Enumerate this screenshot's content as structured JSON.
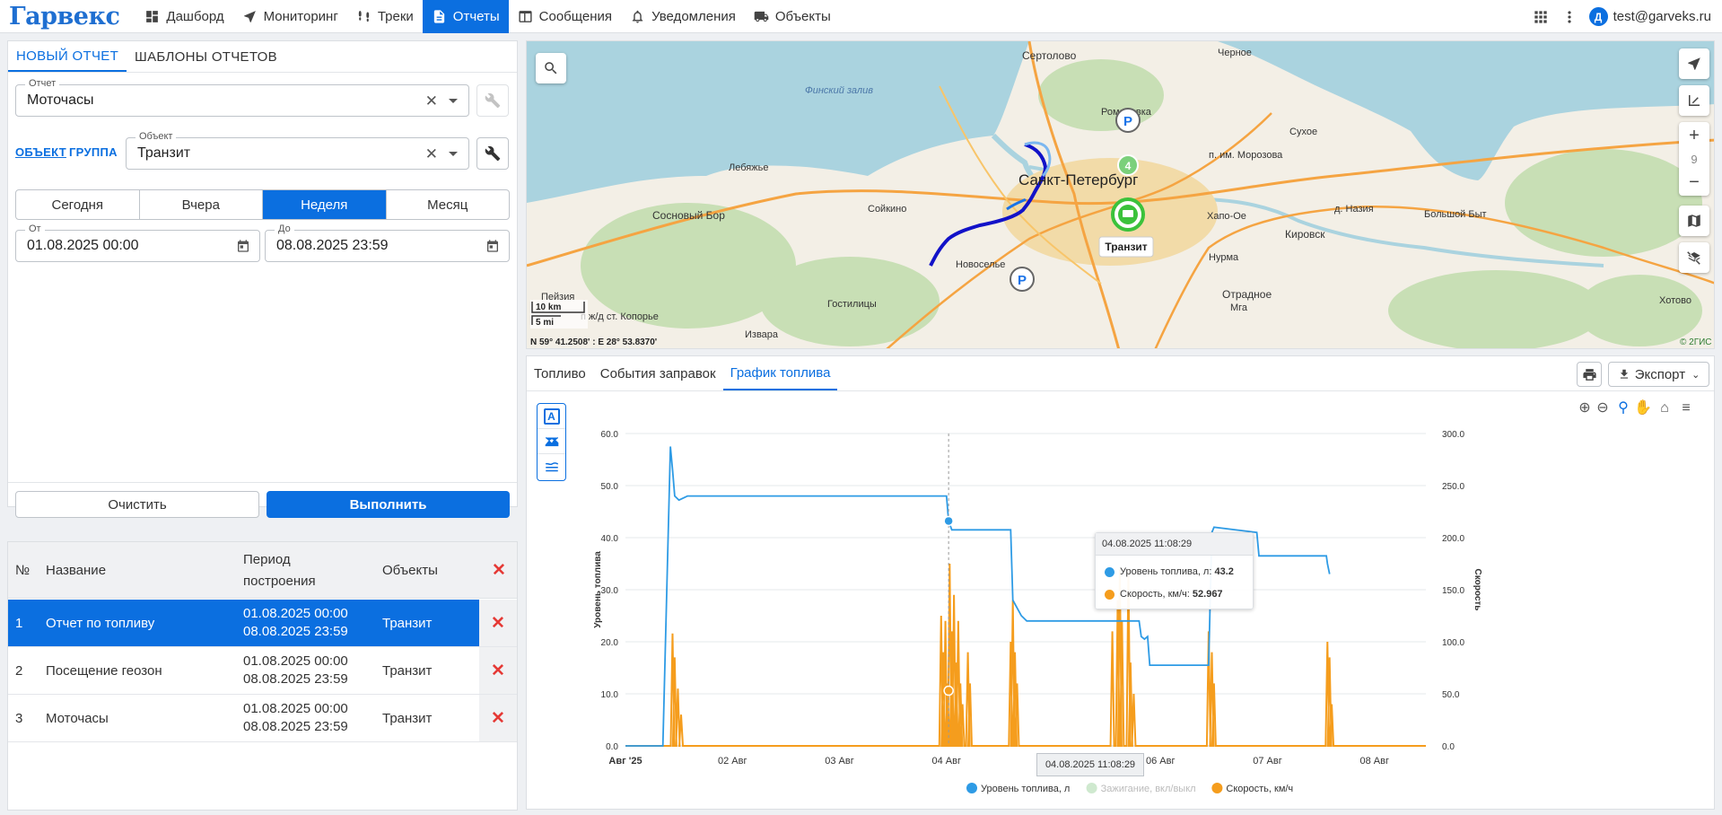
{
  "app": {
    "logo": "Гарвекс",
    "user_email": "test@garveks.ru",
    "user_initial": "Д"
  },
  "nav": [
    {
      "label": "Дашборд",
      "icon": "dashboard-icon"
    },
    {
      "label": "Мониторинг",
      "icon": "navigation-arrow-icon"
    },
    {
      "label": "Треки",
      "icon": "tracks-icon"
    },
    {
      "label": "Отчеты",
      "icon": "report-icon",
      "active": true
    },
    {
      "label": "Сообщения",
      "icon": "messages-icon"
    },
    {
      "label": "Уведомления",
      "icon": "bell-icon"
    },
    {
      "label": "Объекты",
      "icon": "truck-icon"
    }
  ],
  "report_form": {
    "tabs": [
      "НОВЫЙ ОТЧЕТ",
      "ШАБЛОНЫ ОТЧЕТОВ"
    ],
    "report_label": "Отчет",
    "report_value": "Моточасы",
    "object_link": "ОБЪЕКТ",
    "group_link": "ГРУППА",
    "object_label": "Объект",
    "object_value": "Транзит",
    "periods": [
      "Сегодня",
      "Вчера",
      "Неделя",
      "Месяц"
    ],
    "active_period": "Неделя",
    "from_label": "От",
    "from_value": "01.08.2025 00:00",
    "to_label": "До",
    "to_value": "08.08.2025 23:59",
    "clear_label": "Очистить",
    "run_label": "Выполнить"
  },
  "results_table": {
    "headers": {
      "num": "№",
      "name": "Название",
      "period_line1": "Период",
      "period_line2": "построения",
      "objects": "Объекты"
    },
    "rows": [
      {
        "num": "1",
        "name": "Отчет по топливу",
        "period_start": "01.08.2025 00:00",
        "period_end": "08.08.2025 23:59",
        "object": "Транзит",
        "selected": true
      },
      {
        "num": "2",
        "name": "Посещение геозон",
        "period_start": "01.08.2025 00:00",
        "period_end": "08.08.2025 23:59",
        "object": "Транзит",
        "selected": false
      },
      {
        "num": "3",
        "name": "Моточасы",
        "period_start": "01.08.2025 00:00",
        "period_end": "08.08.2025 23:59",
        "object": "Транзит",
        "selected": false
      }
    ]
  },
  "map": {
    "labels": {
      "sestroretsk": "Сертолово",
      "gulf": "Финский залив",
      "spb": "Санкт-Петербург",
      "romanovka": "Романовка",
      "morozova": "п. им. Морозова",
      "sukhoe": "Сухое",
      "chernoe": "Черное",
      "lebyazhye": "Лебяжье",
      "sosnovy": "Сосновый Бор",
      "soykino": "Сойкино",
      "khapo": "Хапо-Ое",
      "nazia": "д. Назия",
      "kirovsk": "Кировск",
      "bolshoy": "Большой Быт",
      "novoselye": "Новоселье",
      "nurma": "Нурма",
      "otradnoe": "Отрадное",
      "mga": "Мга",
      "khotovo": "Хотово",
      "peyzia": "Пейзия",
      "gostilitsy": "Гостилицы",
      "koporye": "п ж/д ст. Копорье",
      "izvara": "Извара",
      "vehicle": "Транзит",
      "cluster": "4",
      "zoom": "9"
    },
    "scale_km": "10 km",
    "scale_mi": "5 mi",
    "coords": "N 59° 41.2508' : E 28° 53.8370'",
    "attribution": "© 2ГИС"
  },
  "chart_tabs": [
    "Топливо",
    "События заправок",
    "График топлива"
  ],
  "export_label": "Экспорт",
  "tooltip": {
    "time": "04.08.2025 11:08:29",
    "fuel_label": "Уровень топлива, л:",
    "fuel_value": "43.2",
    "speed_label": "Скорость, км/ч:",
    "speed_value": "52.967"
  },
  "crosshair_label": "04.08.2025 11:08:29",
  "chart_data": {
    "type": "line",
    "ylabel": "Уровень топлива",
    "y2label": "Скорость",
    "ylim": [
      0,
      60
    ],
    "y2lim": [
      0,
      300
    ],
    "yticks": [
      "0.0",
      "10.0",
      "20.0",
      "30.0",
      "40.0",
      "50.0",
      "60.0"
    ],
    "y2ticks": [
      "0.0",
      "50.0",
      "100.0",
      "150.0",
      "200.0",
      "250.0",
      "300.0"
    ],
    "xticks": [
      "Авг '25",
      "02 Авг",
      "03 Авг",
      "04 Авг",
      "05 Авг",
      "06 Авг",
      "07 Авг",
      "08 Авг"
    ],
    "xlim_days": [
      1.0,
      8.48
    ],
    "legend": [
      {
        "name": "Уровень топлива, л",
        "color": "#2e9be5",
        "disabled": false
      },
      {
        "name": "Зажигание, вкл/выкл",
        "color": "#cfe9cf",
        "disabled": true
      },
      {
        "name": "Скорость, км/ч",
        "color": "#f59d1d",
        "disabled": false
      }
    ],
    "series": [
      {
        "name": "Уровень топлива, л",
        "axis": "left",
        "color": "#2e9be5",
        "points": [
          [
            1.0,
            0
          ],
          [
            1.35,
            0
          ],
          [
            1.42,
            57.5
          ],
          [
            1.44,
            53
          ],
          [
            1.46,
            48
          ],
          [
            1.5,
            47.2
          ],
          [
            1.58,
            48
          ],
          [
            4.0,
            48
          ],
          [
            4.02,
            43.2
          ],
          [
            4.05,
            41.5
          ],
          [
            4.6,
            41.5
          ],
          [
            4.62,
            28
          ],
          [
            4.7,
            25
          ],
          [
            4.75,
            24
          ],
          [
            5.7,
            24
          ],
          [
            5.8,
            24
          ],
          [
            5.82,
            21
          ],
          [
            5.85,
            20.5
          ],
          [
            5.88,
            21
          ],
          [
            5.9,
            15.5
          ],
          [
            6.45,
            15.5
          ],
          [
            6.48,
            41
          ],
          [
            6.5,
            42
          ],
          [
            6.9,
            41
          ],
          [
            6.92,
            36.5
          ],
          [
            7.3,
            36.5
          ],
          [
            7.55,
            36.5
          ],
          [
            7.56,
            35
          ],
          [
            7.58,
            33
          ]
        ]
      },
      {
        "name": "Скорость, км/ч",
        "axis": "right",
        "color": "#f59d1d",
        "bursts": [
          [
            1.44,
            108
          ],
          [
            1.46,
            85
          ],
          [
            1.49,
            55
          ],
          [
            1.52,
            30
          ],
          [
            3.95,
            125
          ],
          [
            3.97,
            90
          ],
          [
            3.99,
            120
          ],
          [
            4.01,
            60
          ],
          [
            4.03,
            175
          ],
          [
            4.05,
            110
          ],
          [
            4.07,
            145
          ],
          [
            4.09,
            80
          ],
          [
            4.11,
            120
          ],
          [
            4.13,
            60
          ],
          [
            4.15,
            40
          ],
          [
            4.2,
            90
          ],
          [
            4.22,
            60
          ],
          [
            4.6,
            100
          ],
          [
            4.62,
            140
          ],
          [
            4.64,
            90
          ],
          [
            4.66,
            60
          ],
          [
            5.55,
            110
          ],
          [
            5.6,
            140
          ],
          [
            5.62,
            170
          ],
          [
            5.64,
            120
          ],
          [
            5.7,
            170
          ],
          [
            5.72,
            80
          ],
          [
            5.75,
            50
          ],
          [
            6.45,
            110
          ],
          [
            6.48,
            90
          ],
          [
            6.5,
            60
          ],
          [
            7.56,
            100
          ],
          [
            7.58,
            85
          ],
          [
            7.6,
            40
          ]
        ]
      }
    ]
  }
}
